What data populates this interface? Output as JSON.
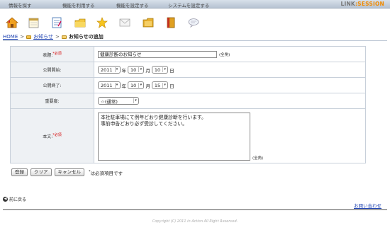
{
  "top_nav": {
    "items": [
      "情報を探す",
      "機能を利用する",
      "機能を設定する",
      "システムを設定する"
    ],
    "logo_prefix": "LINK",
    "logo_suffix": "SESSION"
  },
  "toolbar": {
    "icons": [
      "home-icon",
      "calendar-icon",
      "notepad-icon",
      "folder-icon",
      "star-icon",
      "mail-icon",
      "document-folder-icon",
      "book-icon",
      "chat-icon"
    ]
  },
  "breadcrumb": {
    "home": "HOME",
    "sep1": ">",
    "parent": "お知らせ",
    "sep2": ">",
    "current": "お知らせの追加"
  },
  "form": {
    "title": {
      "label": "表題:",
      "required_mark": "*必須",
      "value": "健康診断のお知らせ",
      "hint": "(全角)"
    },
    "publish_start": {
      "label": "公開開始:",
      "year": "2011",
      "year_unit": "年",
      "month": "10",
      "month_unit": "月",
      "day": "10",
      "day_unit": "日"
    },
    "publish_end": {
      "label": "公開終了:",
      "year": "2011",
      "year_unit": "年",
      "month": "10",
      "month_unit": "月",
      "day": "15",
      "day_unit": "日"
    },
    "importance": {
      "label": "重要度:",
      "value": "☆(通常)"
    },
    "body": {
      "label": "本文:",
      "required_mark": "*必須",
      "value": "本社駐車場にて例年どおり健康診断を行います。\n事前申告どおり必ず受診してください。",
      "hint": "(全角)"
    }
  },
  "buttons": {
    "register": "登録",
    "clear": "クリア",
    "cancel": "キャンセル",
    "note_star": "*",
    "note": "は必須項目です"
  },
  "back_link": "前に戻る",
  "contact_link": "お問い合わせ",
  "copyright": "Copyright (C) 2011 in Action All Right Reserved."
}
